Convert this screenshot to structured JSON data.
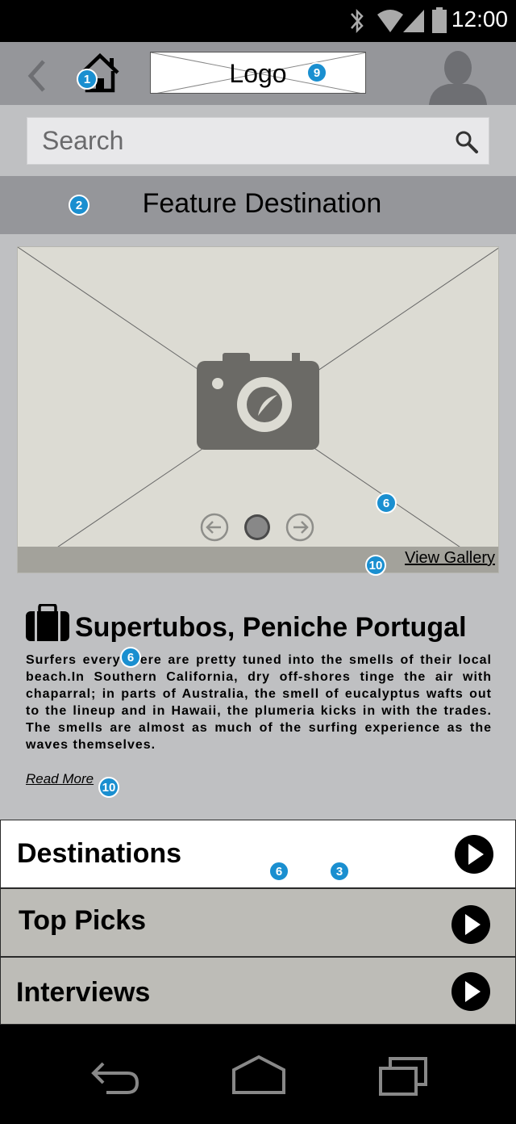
{
  "status_bar": {
    "time": "12:00",
    "icons": [
      "bluetooth-icon",
      "wifi-icon",
      "signal-icon",
      "battery-icon"
    ]
  },
  "app_bar": {
    "back_icon": "chevron-left-icon",
    "home_icon": "home-icon",
    "logo_text": "Logo",
    "avatar_icon": "user-avatar-icon"
  },
  "search": {
    "placeholder": "Search",
    "icon": "search-icon"
  },
  "feature": {
    "title": "Feature Destination",
    "image_icon": "camera-icon",
    "carousel_prev_icon": "arrow-left-circle-icon",
    "carousel_next_icon": "arrow-right-circle-icon",
    "view_gallery": "View Gallery"
  },
  "article": {
    "icon": "suitcase-icon",
    "title": "Supertubos, Peniche Portugal",
    "body": "Surfers everywhere are pretty tuned into the smells of their local beach.In Southern California, dry off-shores tinge the air with chaparral; in parts of Australia, the smell of eucalyptus wafts out to the lineup and in Hawaii, the plumeria kicks in with the trades. The smells are almost as much of the surfing experience as the waves themselves.",
    "read_more": "Read More"
  },
  "menu": [
    {
      "label": "Destinations",
      "icon": "play-circle-icon"
    },
    {
      "label": "Top Picks",
      "icon": "play-circle-icon"
    },
    {
      "label": "Interviews",
      "icon": "play-circle-icon"
    }
  ],
  "annotations": {
    "home": "1",
    "feature": "2",
    "logo": "9",
    "image": "6",
    "gallery": "10",
    "body": "6",
    "read_more": "10",
    "menu_a": "6",
    "menu_b": "3"
  },
  "nav_bar": {
    "icons": [
      "back-nav-icon",
      "home-nav-icon",
      "recents-nav-icon"
    ]
  },
  "colors": {
    "header_gray": "#95969a",
    "background": "#bfc0c2",
    "marker_blue": "#1a8fd0",
    "image_fill": "#dcdbd3"
  }
}
